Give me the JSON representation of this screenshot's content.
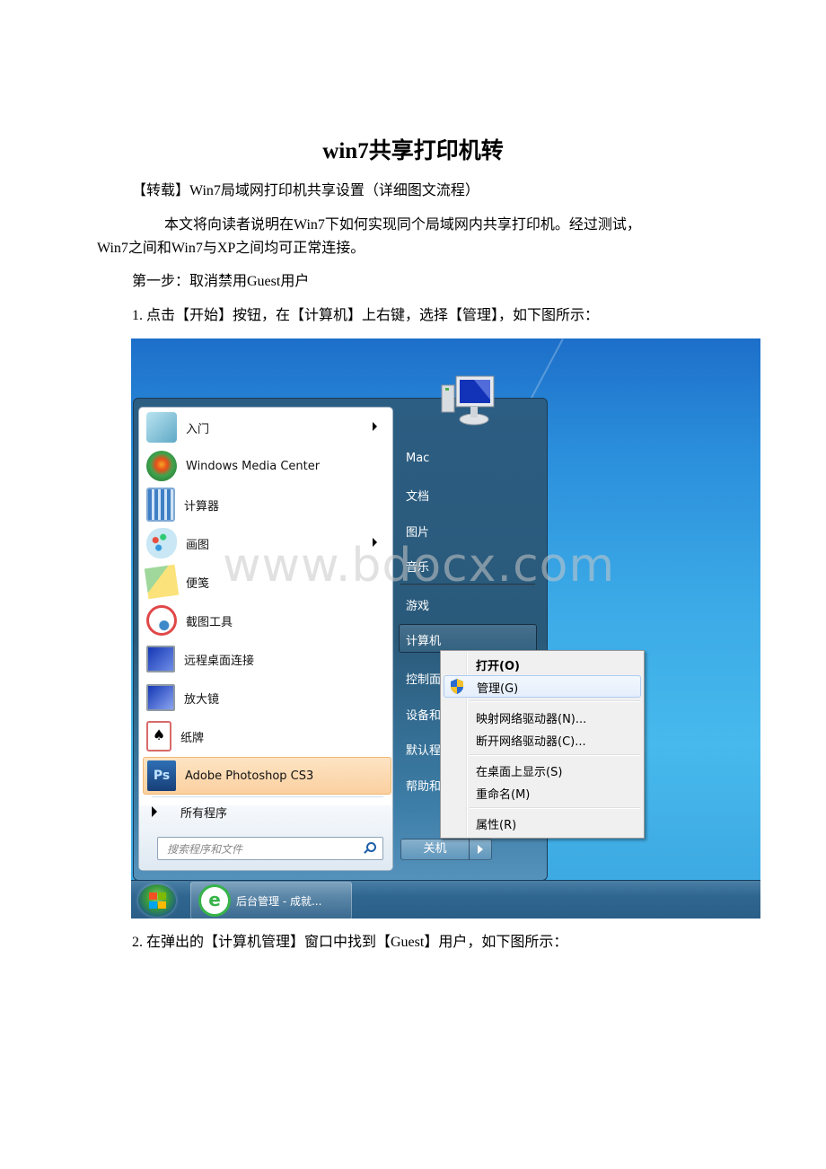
{
  "document": {
    "title": "win7共享打印机转",
    "paragraphs": [
      "【转载】Win7局域网打印机共享设置（详细图文流程）",
      "本文将向读者说明在Win7下如何实现同个局域网内共享打印机。经过测试，",
      "Win7之间和Win7与XP之间均可正常连接。",
      "第一步：取消禁用Guest用户",
      "1. 点击【开始】按钮，在【计算机】上右键，选择【管理】，如下图所示：",
      "2. 在弹出的【计算机管理】窗口中找到【Guest】用户，如下图所示："
    ],
    "watermark": "www.bdocx.com"
  },
  "screenshot": {
    "start_menu": {
      "programs": [
        {
          "label": "入门",
          "icon": "getting-started-icon",
          "has_submenu": true
        },
        {
          "label": "Windows Media Center",
          "icon": "windows-media-center-icon",
          "has_submenu": false
        },
        {
          "label": "计算器",
          "icon": "calculator-icon",
          "has_submenu": false
        },
        {
          "label": "画图",
          "icon": "paint-icon",
          "has_submenu": true
        },
        {
          "label": "便笺",
          "icon": "sticky-notes-icon",
          "has_submenu": false
        },
        {
          "label": "截图工具",
          "icon": "snipping-tool-icon",
          "has_submenu": false
        },
        {
          "label": "远程桌面连接",
          "icon": "remote-desktop-icon",
          "has_submenu": false
        },
        {
          "label": "放大镜",
          "icon": "magnifier-icon",
          "has_submenu": false
        },
        {
          "label": "纸牌",
          "icon": "solitaire-icon",
          "has_submenu": false
        },
        {
          "label": "Adobe Photoshop CS3",
          "icon": "photoshop-icon",
          "has_submenu": false,
          "highlighted": true
        }
      ],
      "all_programs": "所有程序",
      "search_placeholder": "搜索程序和文件",
      "right_links": [
        "Mac",
        "文档",
        "图片",
        "音乐",
        "游戏",
        "计算机",
        "控制面",
        "设备和",
        "默认程",
        "帮助和"
      ],
      "shutdown_label": "关机",
      "photoshop_badge": "Ps"
    },
    "context_menu": {
      "items": [
        {
          "label": "打开(O)",
          "bold": true
        },
        {
          "label": "管理(G)",
          "highlighted": true,
          "icon": "uac-shield-icon"
        },
        {
          "label": "映射网络驱动器(N)..."
        },
        {
          "label": "断开网络驱动器(C)..."
        },
        {
          "label": "在桌面上显示(S)"
        },
        {
          "label": "重命名(M)"
        },
        {
          "label": "属性(R)"
        }
      ]
    },
    "taskbar": {
      "task_label": "后台管理 - 成就...",
      "ie_glyph": "e"
    }
  }
}
